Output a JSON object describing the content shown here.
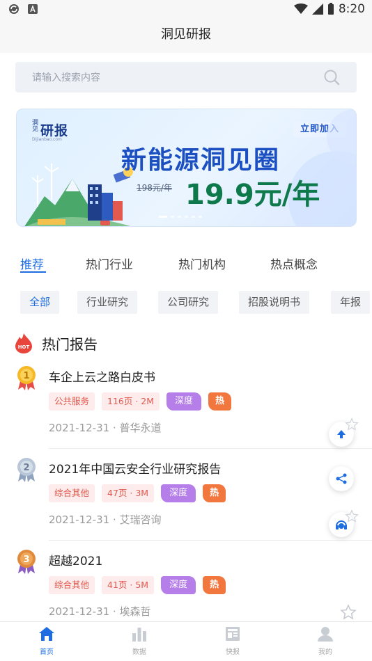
{
  "status_bar": {
    "time": "8:20"
  },
  "header": {
    "title": "洞见研报"
  },
  "search": {
    "placeholder": "请输入搜索内容"
  },
  "banner": {
    "logo_small": "洞见",
    "logo_main": "研报",
    "logo_url": "Dijianbao.com",
    "join_label": "立即加入",
    "headline": "新能源洞见圈",
    "old_price": "198元/年",
    "new_price": "19.9元/年"
  },
  "tabs": [
    "推荐",
    "热门行业",
    "热门机构",
    "热点概念"
  ],
  "chips": [
    "全部",
    "行业研究",
    "公司研究",
    "招股说明书",
    "年报"
  ],
  "section": {
    "title": "热门报告",
    "hot_badge": "HOT"
  },
  "reports": [
    {
      "rank": "1",
      "title": "车企上云之路白皮书",
      "category": "公共服务",
      "pages": "116页 · 2M",
      "deep": "深度",
      "hot": "热",
      "meta": "2021-12-31 · 普华永道"
    },
    {
      "rank": "2",
      "title": "2021年中国云安全行业研究报告",
      "category": "综合其他",
      "pages": "47页 · 3M",
      "deep": "深度",
      "hot": "热",
      "meta": "2021-12-31 · 艾瑞咨询"
    },
    {
      "rank": "3",
      "title": "超越2021",
      "category": "综合其他",
      "pages": "41页 · 5M",
      "deep": "深度",
      "hot": "热",
      "meta": "2021-12-31 · 埃森哲"
    }
  ],
  "bottom_nav": [
    {
      "label": "首页",
      "icon": "home-icon",
      "active": true
    },
    {
      "label": "数据",
      "icon": "bar-chart-icon",
      "active": false
    },
    {
      "label": "快报",
      "icon": "newspaper-icon",
      "active": false
    },
    {
      "label": "我的",
      "icon": "person-icon",
      "active": false
    }
  ],
  "colors": {
    "accent": "#1e6de0",
    "deep_tag": "#b57ee8",
    "hot_tag": "#f2773f",
    "price_green": "#0e7a4c"
  }
}
